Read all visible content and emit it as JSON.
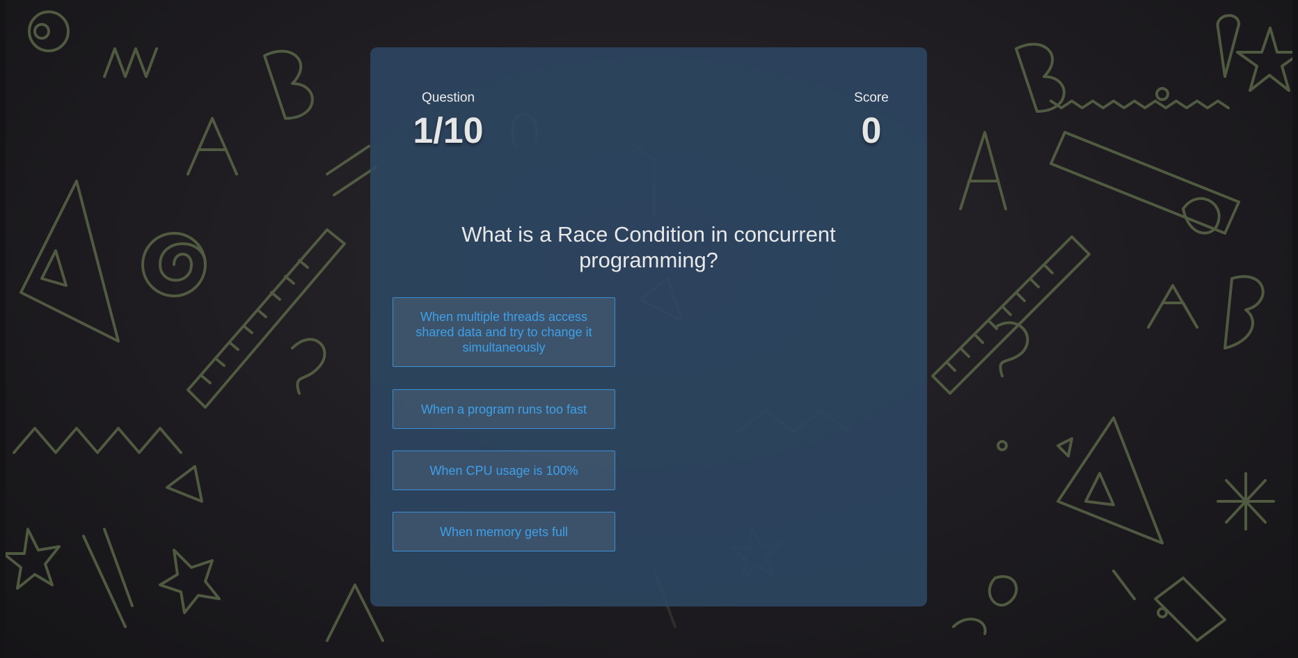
{
  "hud": {
    "question_label": "Question",
    "question_progress": "1/10",
    "score_label": "Score",
    "score_value": "0"
  },
  "question": {
    "text": "What is a Race Condition in concurrent programming?"
  },
  "choices": [
    {
      "label": "When multiple threads access shared data and try to change it simultaneously"
    },
    {
      "label": "When a program runs too fast"
    },
    {
      "label": "When CPU usage is 100%"
    },
    {
      "label": "When memory gets full"
    }
  ],
  "colors": {
    "background": "#1e1c20",
    "doodle": "#5d6b4a",
    "card": "#2d4864",
    "choice_border": "#3a8fd6",
    "choice_text": "#3ea0ea",
    "text": "#e8e8e8"
  },
  "icons": {
    "background": "chalkboard-doodles-pattern"
  }
}
